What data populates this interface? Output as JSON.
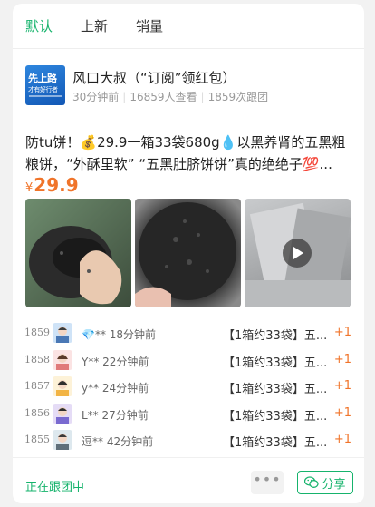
{
  "tabs": [
    "默认",
    "上新",
    "销量"
  ],
  "header": {
    "logo_text_1": "先上路",
    "logo_text_2": "才有好行者",
    "group_name": "风口大叔（“订阅”领红包）",
    "time_ago": "30分钟前",
    "views": "16859人查看",
    "joined": "1859次跟团"
  },
  "post": {
    "description": "防tu饼！💰29.9一箱33袋680g💧以黑养肾的五黑粗粮饼，“外酥里软” “五黑肚脐饼饼”真的绝绝子💯...",
    "currency": "¥",
    "price": "29.9"
  },
  "orders": [
    {
      "num": "1859",
      "nick": "💎** 18分钟前",
      "item": "【1箱约33袋】五...",
      "qty": "+1"
    },
    {
      "num": "1858",
      "nick": "Y** 22分钟前",
      "item": "【1箱约33袋】五...",
      "qty": "+1"
    },
    {
      "num": "1857",
      "nick": "y** 24分钟前",
      "item": "【1箱约33袋】五...",
      "qty": "+1"
    },
    {
      "num": "1856",
      "nick": "L** 27分钟前",
      "item": "【1箱约33袋】五...",
      "qty": "+1"
    },
    {
      "num": "1855",
      "nick": "逗** 42分钟前",
      "item": "【1箱约33袋】五...",
      "qty": "+1"
    }
  ],
  "footer": {
    "status": "正在跟团中",
    "more": "•••",
    "share": "分享"
  },
  "colors": {
    "accent_green": "#16b36c",
    "price_orange": "#f0742a"
  }
}
